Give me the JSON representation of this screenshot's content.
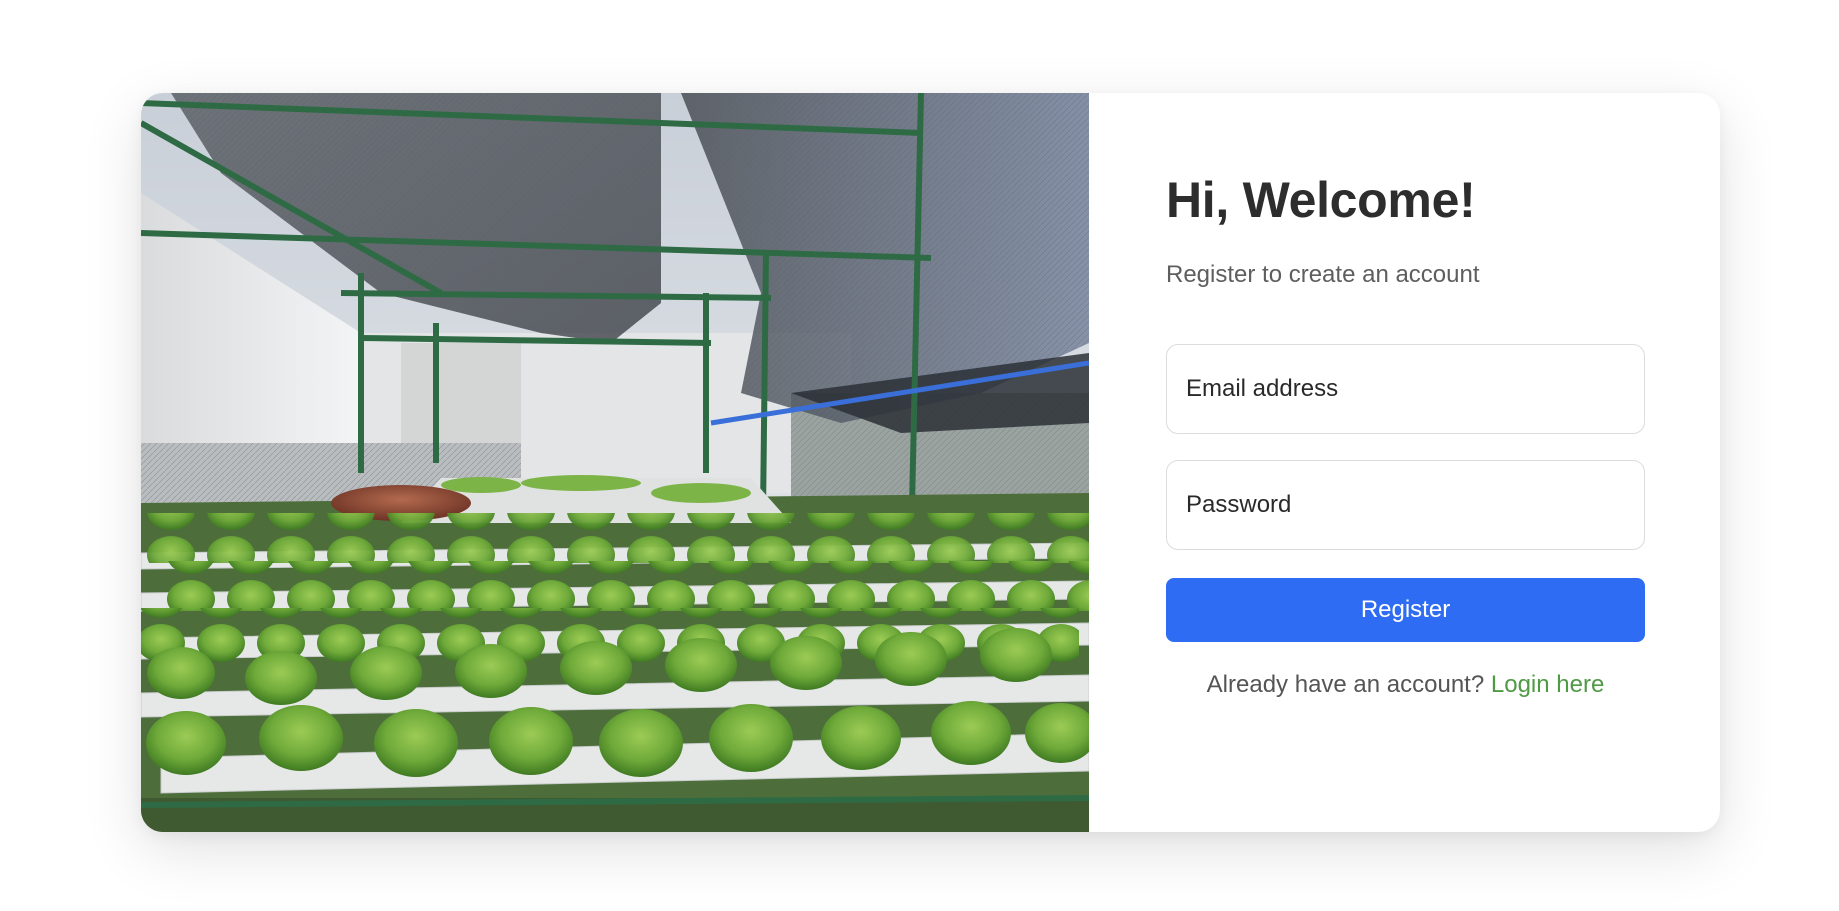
{
  "hero": {
    "image_description_name": "greenhouse-lettuce-photo"
  },
  "form": {
    "title": "Hi, Welcome!",
    "subtitle": "Register to create an account",
    "email_placeholder": "Email address",
    "password_placeholder": "Password",
    "register_label": "Register",
    "login_prompt": "Already have an account?",
    "login_link": "Login here"
  },
  "colors": {
    "primary": "#2f6cf4",
    "link": "#4f9a44",
    "title": "#2d2d2d",
    "muted": "#5e5e5e"
  }
}
